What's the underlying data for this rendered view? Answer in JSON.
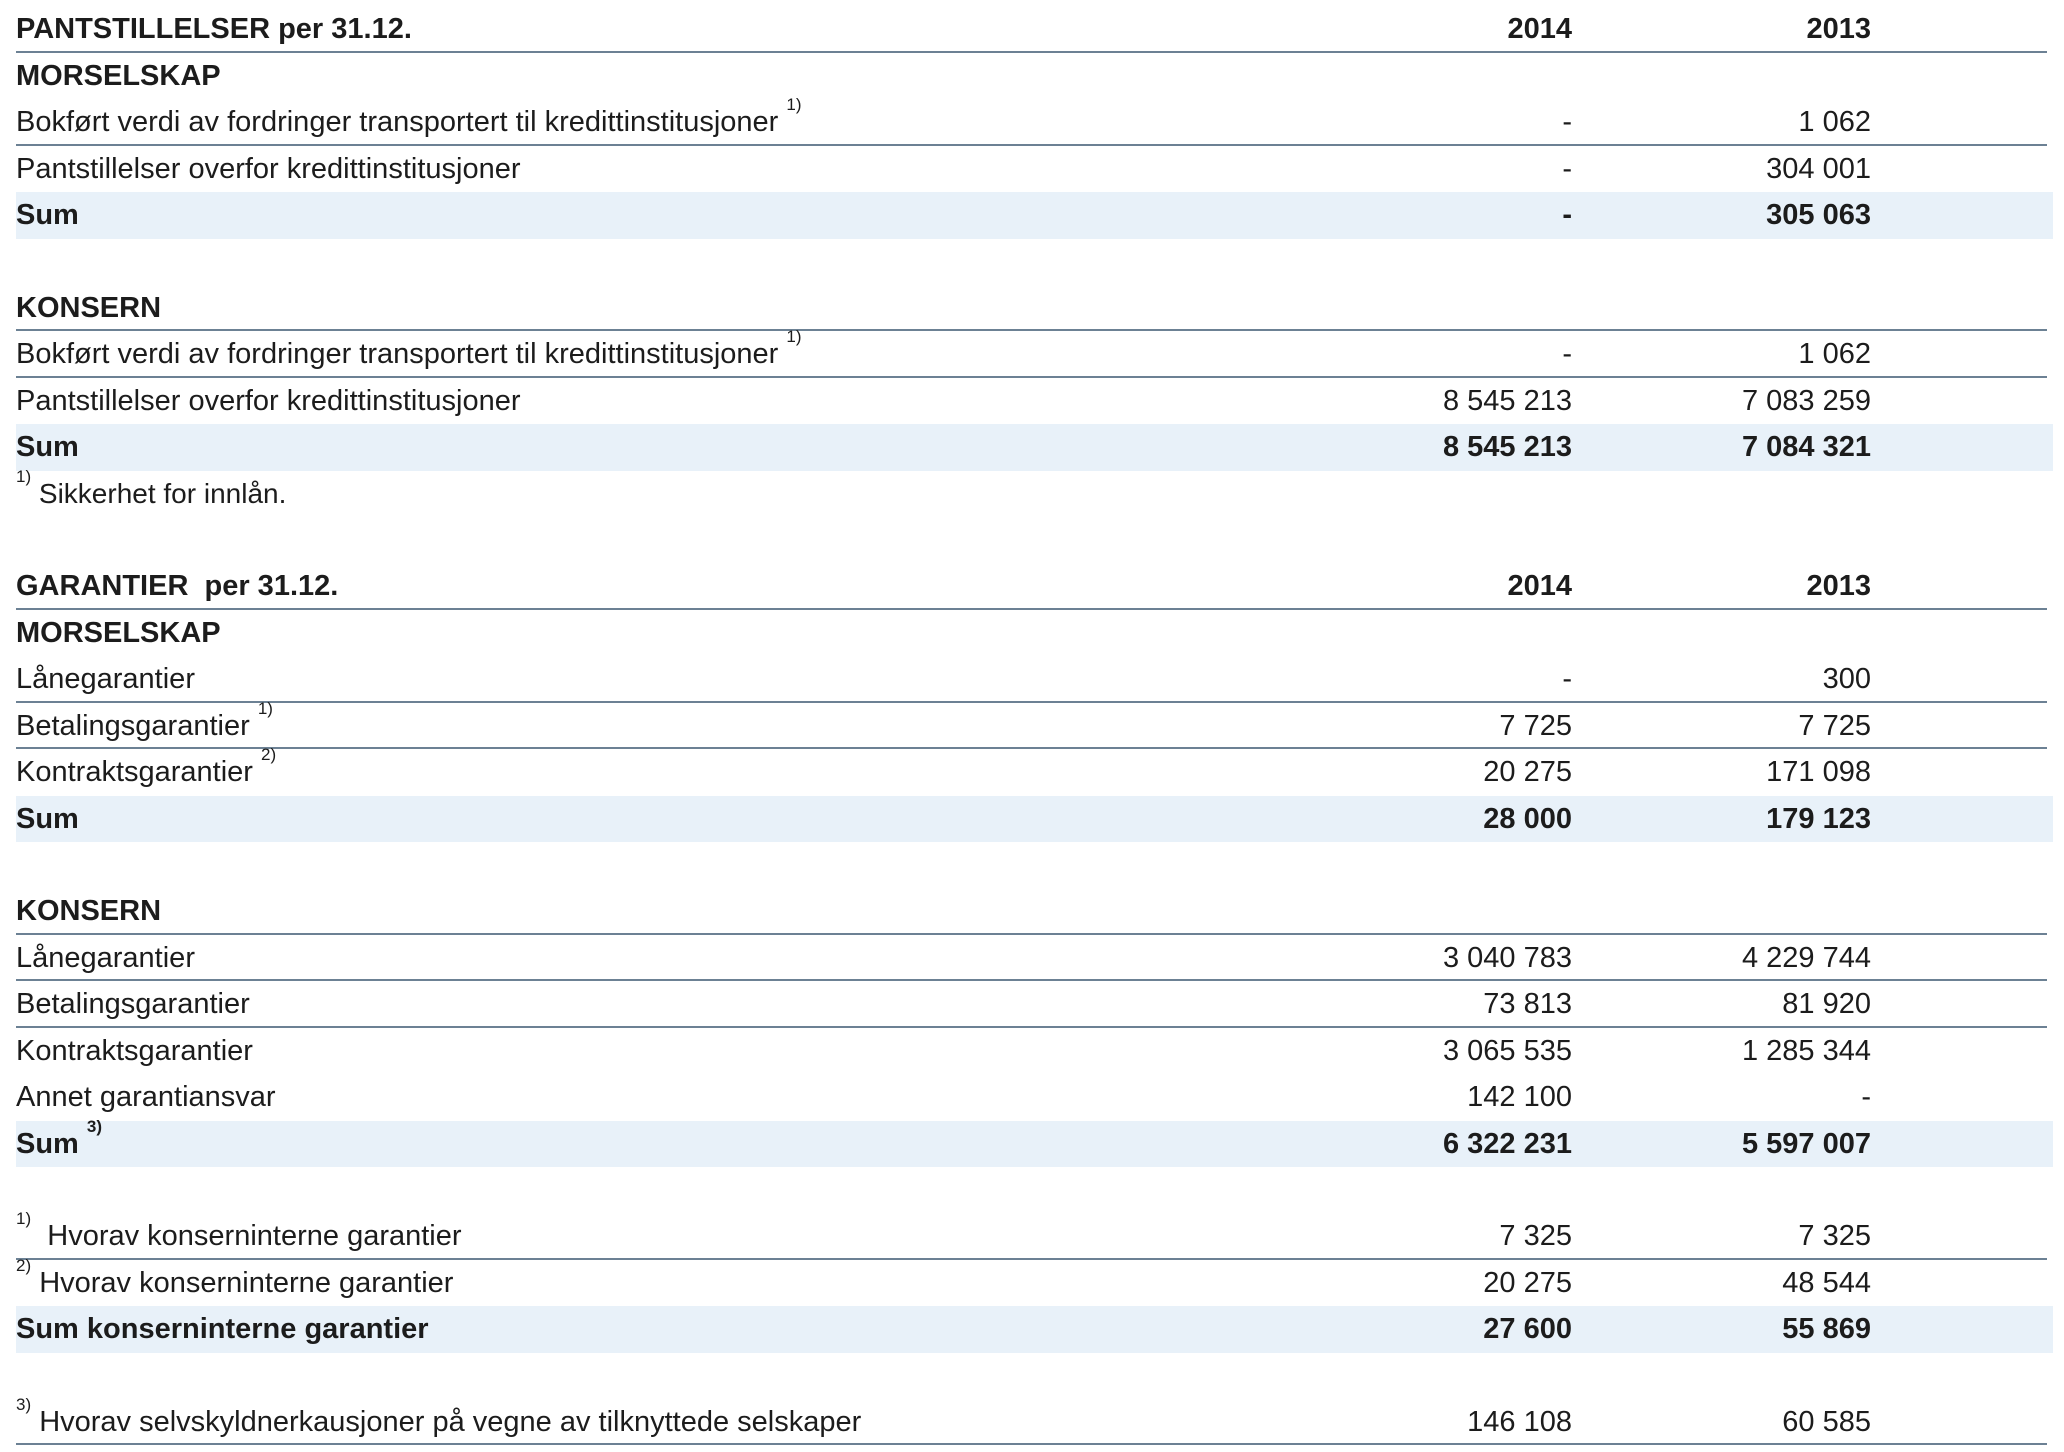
{
  "pant": {
    "title": "PANTSTILLELSER per 31.12.",
    "col1": "2014",
    "col2": "2013",
    "mor": {
      "heading": "MORSELSKAP",
      "rows": [
        {
          "label": "Bokført verdi av fordringer transportert til kredittinstitusjoner",
          "sup": "1)",
          "v1": "-",
          "v2": "1 062"
        },
        {
          "label": "Pantstillelser overfor kredittinstitusjoner",
          "v1": "-",
          "v2": "304 001"
        }
      ],
      "sum": {
        "label": "Sum",
        "v1": "-",
        "v2": "305 063"
      }
    },
    "kon": {
      "heading": "KONSERN",
      "rows": [
        {
          "label": "Bokført verdi av fordringer transportert til kredittinstitusjoner",
          "sup": "1)",
          "v1": "-",
          "v2": "1 062"
        },
        {
          "label": "Pantstillelser overfor kredittinstitusjoner",
          "v1": "8 545 213",
          "v2": "7 083 259"
        }
      ],
      "sum": {
        "label": "Sum",
        "v1": "8 545 213",
        "v2": "7 084 321"
      }
    },
    "footnote": {
      "sup": "1)",
      "text": "Sikkerhet for innlån."
    }
  },
  "gar": {
    "title": "GARANTIER  per 31.12.",
    "col1": "2014",
    "col2": "2013",
    "mor": {
      "heading": "MORSELSKAP",
      "rows": [
        {
          "label": "Lånegarantier",
          "v1": "-",
          "v2": "300"
        },
        {
          "label": "Betalingsgarantier",
          "sup": "1)",
          "v1": "7 725",
          "v2": "7 725"
        },
        {
          "label": "Kontraktsgarantier",
          "sup": "2)",
          "v1": "20 275",
          "v2": "171 098"
        }
      ],
      "sum": {
        "label": "Sum",
        "v1": "28 000",
        "v2": "179 123"
      }
    },
    "kon": {
      "heading": "KONSERN",
      "rows": [
        {
          "label": "Lånegarantier",
          "v1": "3 040 783",
          "v2": "4 229 744"
        },
        {
          "label": "Betalingsgarantier",
          "v1": "73 813",
          "v2": "81 920"
        },
        {
          "label": "Kontraktsgarantier",
          "v1": "3 065 535",
          "v2": "1 285 344"
        },
        {
          "label": "Annet garantiansvar",
          "v1": "142 100",
          "v2": "-"
        }
      ],
      "sum": {
        "label": "Sum",
        "sup": "3)",
        "v1": "6 322 231",
        "v2": "5 597 007"
      }
    },
    "intern": {
      "rows": [
        {
          "sup": "1)",
          "label": "Hvorav konserninterne garantier",
          "v1": "7 325",
          "v2": "7 325"
        },
        {
          "sup": "2)",
          "label": "Hvorav konserninterne garantier",
          "v1": "20 275",
          "v2": "48 544"
        }
      ],
      "sum": {
        "label": "Sum konserninterne garantier",
        "v1": "27 600",
        "v2": "55 869"
      }
    },
    "selv": {
      "sup": "3)",
      "label": "Hvorav selvskyldnerkausjoner på vegne av tilknyttede selskaper",
      "v1": "146 108",
      "v2": "60 585"
    }
  }
}
